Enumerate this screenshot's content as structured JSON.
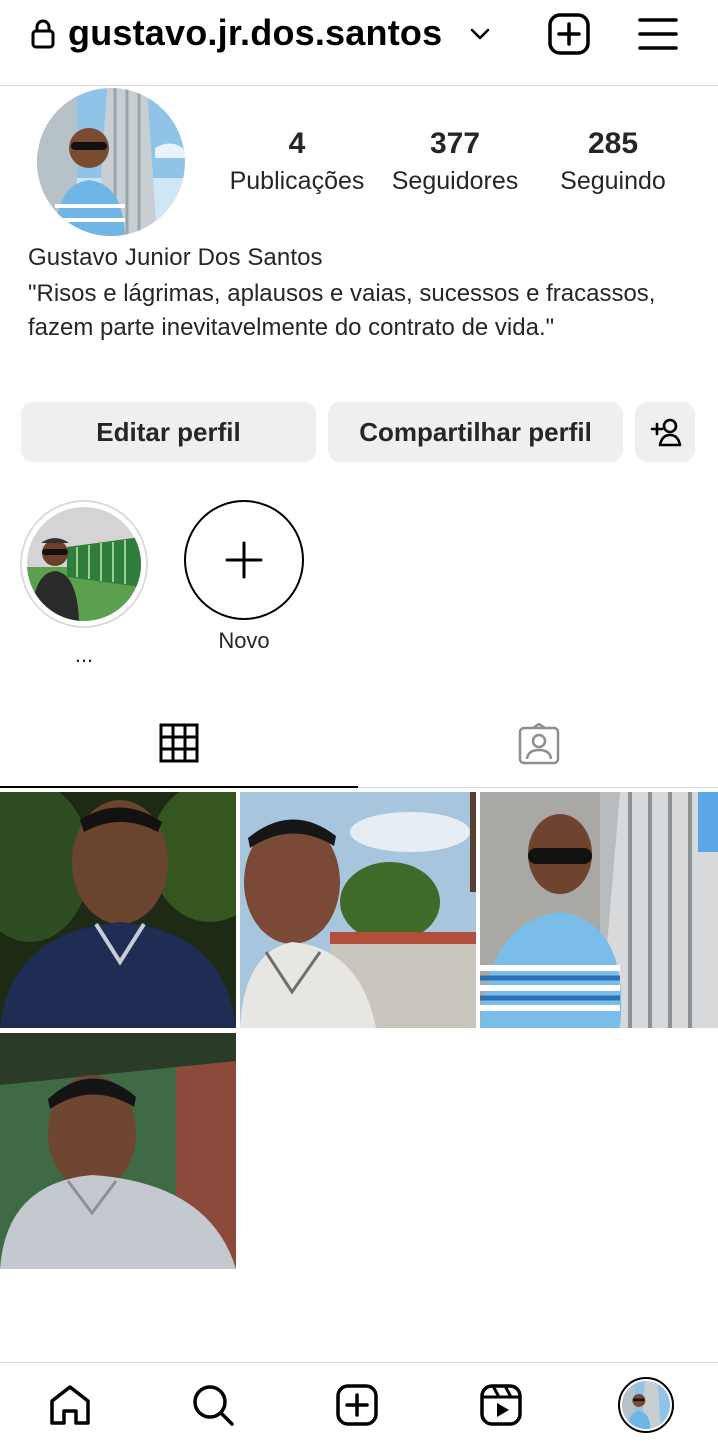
{
  "header": {
    "username": "gustavo.jr.dos.santos",
    "icons": [
      "lock-icon",
      "chevron-down-icon",
      "add-post-icon",
      "menu-icon"
    ]
  },
  "profile": {
    "stats": [
      {
        "value": "4",
        "label": "Publicações"
      },
      {
        "value": "377",
        "label": "Seguidores"
      },
      {
        "value": "285",
        "label": "Seguindo"
      }
    ],
    "full_name": "Gustavo Junior Dos Santos",
    "bio": "\"Risos e lágrimas, aplausos e vaias, sucessos e fracassos, fazem parte inevitavelmente do contrato de vida.\""
  },
  "actions": {
    "edit_label": "Editar perfil",
    "share_label": "Compartilhar perfil",
    "discover_icon": "add-person-icon"
  },
  "highlights": [
    {
      "label": "..."
    },
    {
      "label": "Novo"
    }
  ],
  "tabs": [
    {
      "icon": "grid-icon",
      "active": true
    },
    {
      "icon": "tagged-person-icon",
      "active": false
    }
  ],
  "posts_count": 4,
  "bottom_nav": [
    "home-icon",
    "search-icon",
    "create-icon",
    "reels-icon",
    "profile-avatar"
  ],
  "colors": {
    "text": "#262626",
    "button_bg": "#efefef",
    "divider": "#dbdbdb"
  }
}
